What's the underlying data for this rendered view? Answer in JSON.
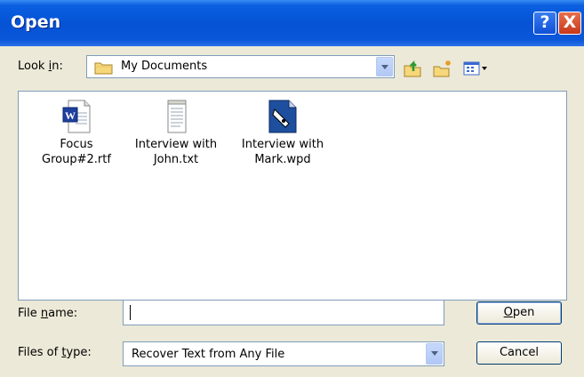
{
  "window": {
    "title": "Open"
  },
  "title_buttons": {
    "help": "?",
    "close": "X"
  },
  "lookin": {
    "label_pre": "Look ",
    "label_u": "i",
    "label_post": "n:",
    "value": "My Documents"
  },
  "toolbar": {
    "icons": [
      "up-folder-icon",
      "new-folder-icon",
      "views-menu-icon"
    ]
  },
  "files": [
    {
      "name_line1": "Focus",
      "name_line2": "Group#2.rtf",
      "icon": "word-document-icon"
    },
    {
      "name_line1": "Interview with",
      "name_line2": "John.txt",
      "icon": "text-file-icon"
    },
    {
      "name_line1": "Interview with",
      "name_line2": "Mark.wpd",
      "icon": "wordperfect-document-icon"
    }
  ],
  "filename": {
    "label_pre": "File ",
    "label_u": "n",
    "label_post": "ame:",
    "value": ""
  },
  "filetype": {
    "label_pre": "Files of ",
    "label_u": "t",
    "label_post": "ype:",
    "value": "Recover Text from Any File"
  },
  "buttons": {
    "open_u": "O",
    "open_rest": "pen",
    "cancel": "Cancel"
  },
  "colors": {
    "title_blue": "#0653d6",
    "close_red": "#c8381a",
    "dialog_bg": "#ece9d8"
  }
}
